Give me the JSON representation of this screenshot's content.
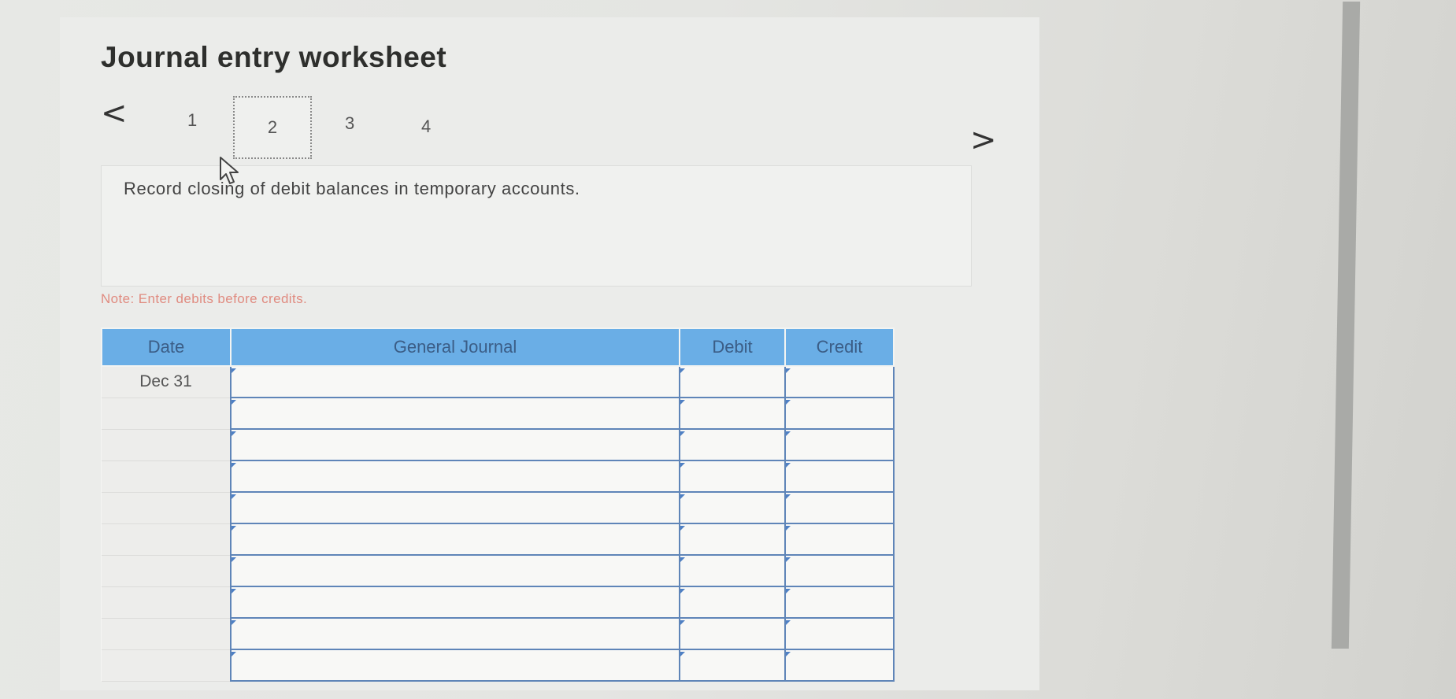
{
  "header": {
    "title": "Journal entry worksheet"
  },
  "pager": {
    "prev_symbol": "<",
    "next_symbol": ">",
    "steps": [
      "1",
      "2",
      "3",
      "4"
    ],
    "active_step": "2"
  },
  "instruction": {
    "text": "Record closing of debit balances in temporary accounts."
  },
  "note": {
    "text": "Note: Enter debits before credits."
  },
  "journal": {
    "columns": [
      "Date",
      "General Journal",
      "Debit",
      "Credit"
    ],
    "rows": [
      {
        "date": "Dec 31",
        "account": "",
        "debit": "",
        "credit": ""
      },
      {
        "date": "",
        "account": "",
        "debit": "",
        "credit": ""
      },
      {
        "date": "",
        "account": "",
        "debit": "",
        "credit": ""
      },
      {
        "date": "",
        "account": "",
        "debit": "",
        "credit": ""
      },
      {
        "date": "",
        "account": "",
        "debit": "",
        "credit": ""
      },
      {
        "date": "",
        "account": "",
        "debit": "",
        "credit": ""
      },
      {
        "date": "",
        "account": "",
        "debit": "",
        "credit": ""
      },
      {
        "date": "",
        "account": "",
        "debit": "",
        "credit": ""
      },
      {
        "date": "",
        "account": "",
        "debit": "",
        "credit": ""
      },
      {
        "date": "",
        "account": "",
        "debit": "",
        "credit": ""
      }
    ]
  },
  "colors": {
    "header_blue": "#6aaee6",
    "grid_blue": "#5f85b8",
    "note_red": "#e08b80"
  },
  "icons": {
    "prev": "chevron-left-icon",
    "next": "chevron-right-icon",
    "pointer": "mouse-cursor-icon"
  }
}
